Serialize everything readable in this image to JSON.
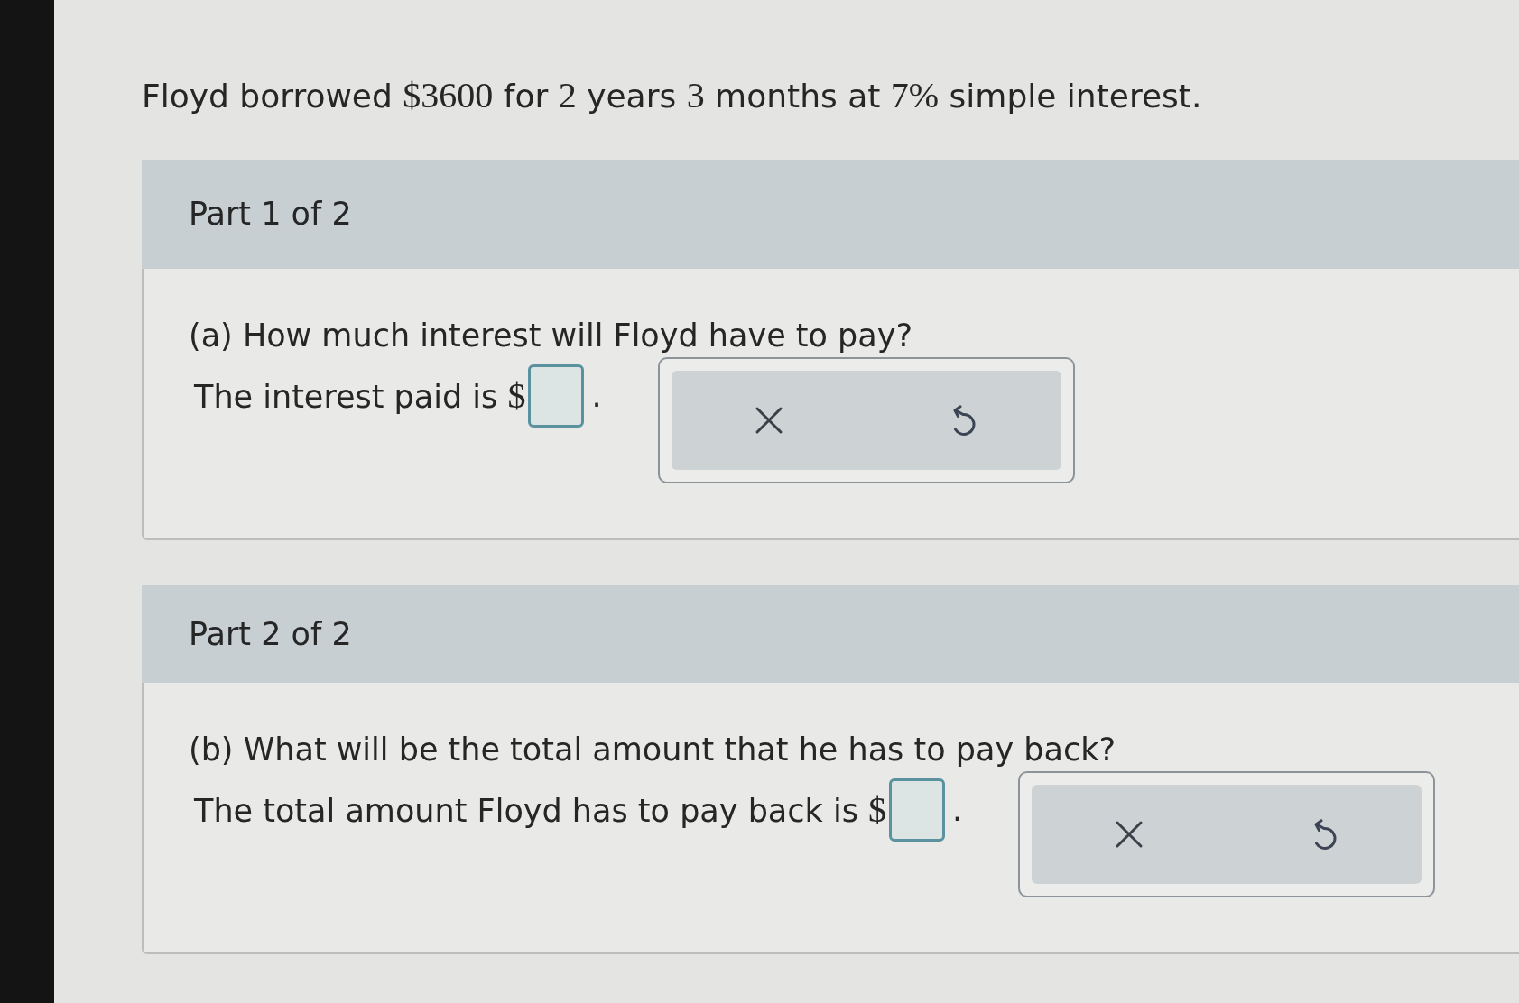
{
  "statement": [
    {
      "kind": "text",
      "text": "Floyd borrowed "
    },
    {
      "kind": "math",
      "text": "$3600"
    },
    {
      "kind": "text",
      "text": " for "
    },
    {
      "kind": "math",
      "text": "2"
    },
    {
      "kind": "text",
      "text": " years "
    },
    {
      "kind": "math",
      "text": "3"
    },
    {
      "kind": "text",
      "text": " months at "
    },
    {
      "kind": "math",
      "text": "7%"
    },
    {
      "kind": "text",
      "text": " simple interest."
    }
  ],
  "parts": [
    {
      "header": "Part 1 of 2",
      "question": "(a) How much interest will Floyd have to pay?",
      "answer_line": [
        {
          "kind": "text",
          "text": "The interest paid is "
        },
        {
          "kind": "math",
          "text": "$"
        },
        {
          "kind": "field"
        },
        {
          "kind": "text",
          "text": "."
        }
      ]
    },
    {
      "header": "Part 2 of 2",
      "question": "(b) What will be the total amount that he has to pay back?",
      "answer_line": [
        {
          "kind": "text",
          "text": "The total amount Floyd has to pay back is "
        },
        {
          "kind": "math",
          "text": "$"
        },
        {
          "kind": "field"
        },
        {
          "kind": "text",
          "text": "."
        }
      ]
    }
  ]
}
